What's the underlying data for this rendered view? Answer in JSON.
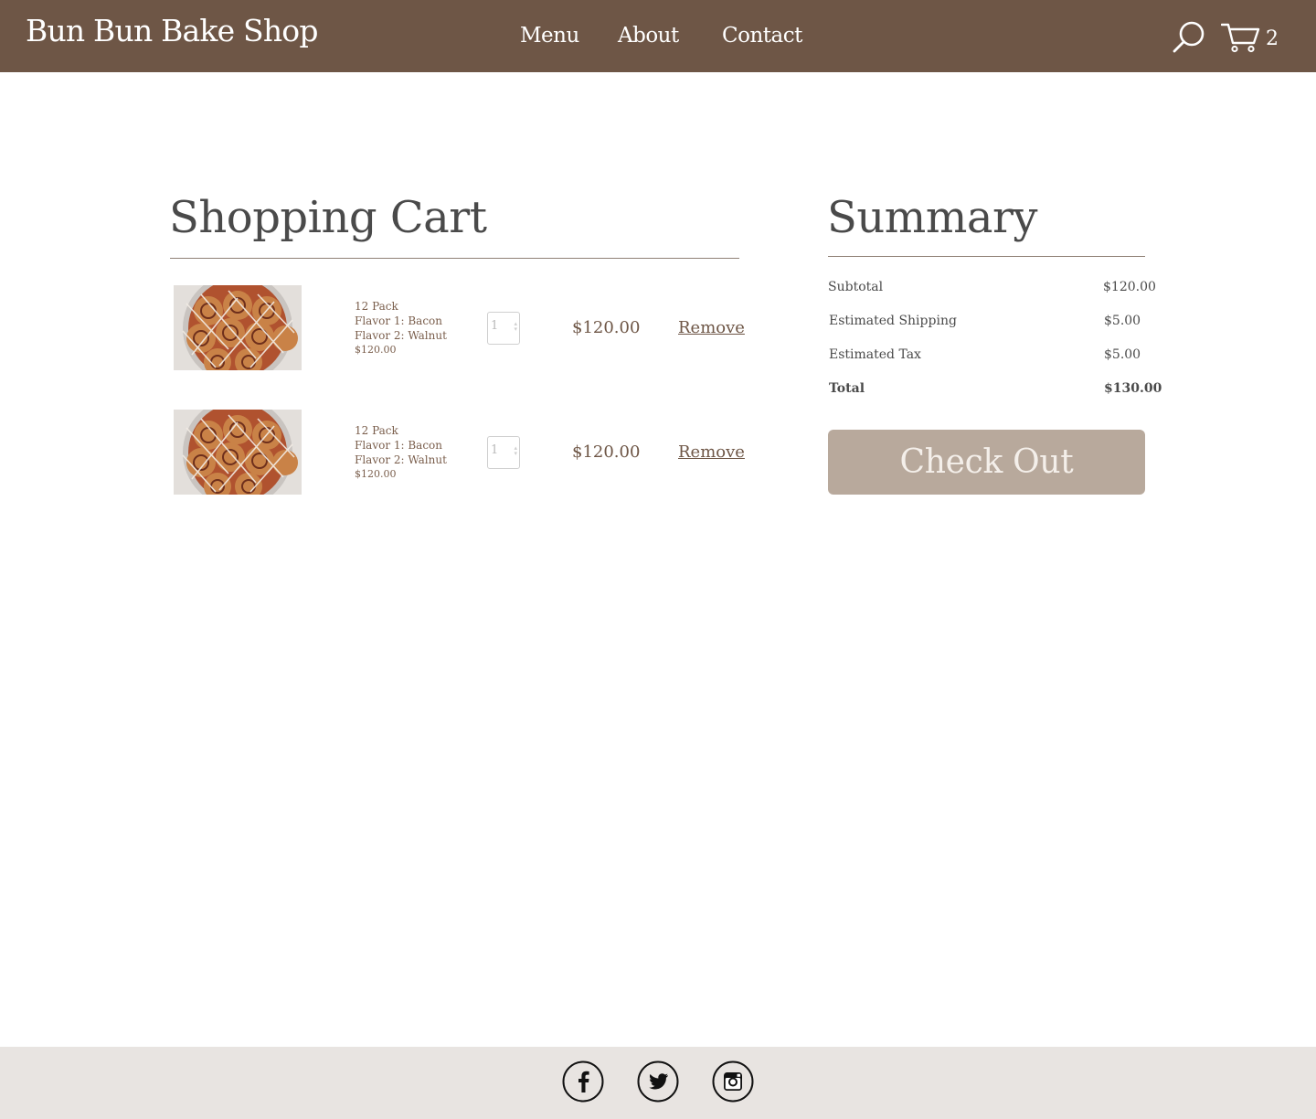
{
  "header": {
    "brand": "Bun Bun Bake Shop",
    "nav": {
      "menu": "Menu",
      "about": "About",
      "contact": "Contact"
    },
    "cart_count": "2",
    "icons": [
      "search-icon",
      "cart-icon"
    ]
  },
  "cart": {
    "title": "Shopping Cart",
    "items": [
      {
        "pack": "12 Pack",
        "flavor1": "Flavor 1: Bacon",
        "flavor2": "Flavor 2: Walnut",
        "unit_price": "$120.00",
        "quantity": "1",
        "line_total": "$120.00",
        "remove_label": "Remove"
      },
      {
        "pack": "12 Pack",
        "flavor1": "Flavor 1: Bacon",
        "flavor2": "Flavor 2: Walnut",
        "unit_price": "$120.00",
        "quantity": "1",
        "line_total": "$120.00",
        "remove_label": "Remove"
      }
    ]
  },
  "summary": {
    "title": "Summary",
    "subtotal_label": "Subtotal",
    "subtotal": "$120.00",
    "shipping_label": "Estimated Shipping",
    "shipping": "$5.00",
    "tax_label": "Estimated Tax",
    "tax": "$5.00",
    "total_label": "Total",
    "total": "$130.00",
    "checkout_label": "Check Out"
  },
  "footer": {
    "social_icons": [
      "facebook-icon",
      "twitter-icon",
      "instagram-icon"
    ]
  },
  "colors": {
    "header_bg": "#6e5646",
    "checkout_bg": "#b8a99c",
    "footer_bg": "#e8e4e1",
    "accent_text": "#6e5646"
  }
}
